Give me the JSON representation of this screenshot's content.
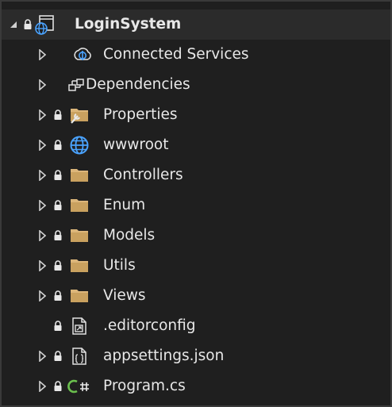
{
  "tree": {
    "project": {
      "label": "LoginSystem"
    },
    "items": [
      {
        "label": "Connected Services"
      },
      {
        "label": "Dependencies"
      },
      {
        "label": "Properties"
      },
      {
        "label": "wwwroot"
      },
      {
        "label": "Controllers"
      },
      {
        "label": "Enum"
      },
      {
        "label": "Models"
      },
      {
        "label": "Utils"
      },
      {
        "label": "Views"
      },
      {
        "label": ".editorconfig"
      },
      {
        "label": "appsettings.json"
      },
      {
        "label": "Program.cs"
      }
    ]
  },
  "colors": {
    "background": "#1f1f1f",
    "lock": "#e8e8e8",
    "folder": "#dcb67a",
    "globe": "#4aa3ff",
    "csharp": "#6bbf4e",
    "text": "#e8e8e8"
  },
  "icons": {
    "project": "web-project-icon",
    "connected": "connected-services-icon",
    "dependencies": "dependencies-icon",
    "properties": "properties-folder-icon",
    "wwwroot": "globe-icon",
    "folder": "folder-icon",
    "config": "config-file-icon",
    "json": "json-file-icon",
    "csharp": "csharp-file-icon",
    "lock": "lock-icon",
    "collapsed": "chevron-right-icon",
    "expanded": "chevron-down-icon"
  }
}
